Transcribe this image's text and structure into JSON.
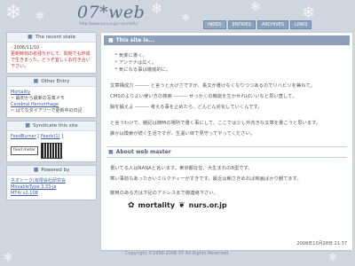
{
  "header": {
    "logo": "07*web",
    "url": "http://www.nurs.or.jp/~mortality/",
    "nav": [
      "INDEX",
      "ENTRIES",
      "ARCHIVES",
      "LINKS"
    ]
  },
  "sidebar": {
    "recent": {
      "title": "The recent state",
      "date": "- 2006/11/10 -",
      "text": "更新時刻の名残りがして、問題でも作成で生きまった。どうぞ宜しくお付き合い下さい。"
    },
    "other": {
      "title": "Other Entry",
      "items": [
        {
          "link": "Mortality",
          "text": "~ 最初から最新の写真メモ"
        },
        {
          "link": "Cerebral Hemorrhage",
          "text": "~ はてなダイアリーで更新中の日記"
        }
      ]
    },
    "syndicate": {
      "title": "Syndicate this site",
      "links": [
        "FeedBurner",
        "Feeds(1)"
      ],
      "badge": "feed meter"
    },
    "powered": {
      "title": "Powered by",
      "items": [
        "ネオトーク(有限会社研究会",
        "MovableType 3.33-ja",
        "MT4i v2.108"
      ]
    }
  },
  "main": {
    "section_title": "This site is...",
    "list": [
      "気楽に書く。",
      "アンテナは広く。",
      "気になる事は徹底的に。"
    ],
    "paragraphs": [
      "文章構成力 ――― と言うと大げさですが、長文が書けなくなりつつあるのでリハビリを兼ねて。",
      "CMSのよりよい使い方の検索 ――― せっかくの機能を生かせればいいなと思い直して。",
      "脳を鍛えよ ――― 考える事を止めたら、どんどん劣化していくんです。",
      "と言うわけで、雑記は随時の場所で書く事にして、ここでは少し外向きな文章を書こうと思います。",
      "誰かは模索が続く生活ですが、生温い目で見守ってやってください。"
    ],
    "about_title": "About web master",
    "about": [
      "書いてる人はNANAと言います。東京都在住、大生まれのB型です。",
      "寒い事前もあったかいミルクティーがすきです。最近は朝さきめれば映画ばかり観てます。",
      "御用のある方は下記のアドレスまで御連絡下さい。"
    ],
    "banner": [
      "mortality",
      "nurs.or.jp"
    ],
    "datetime": "2006年10月28日 21:37"
  },
  "footer": "Copyright ©1998-2006 07 All Rights Reserved."
}
